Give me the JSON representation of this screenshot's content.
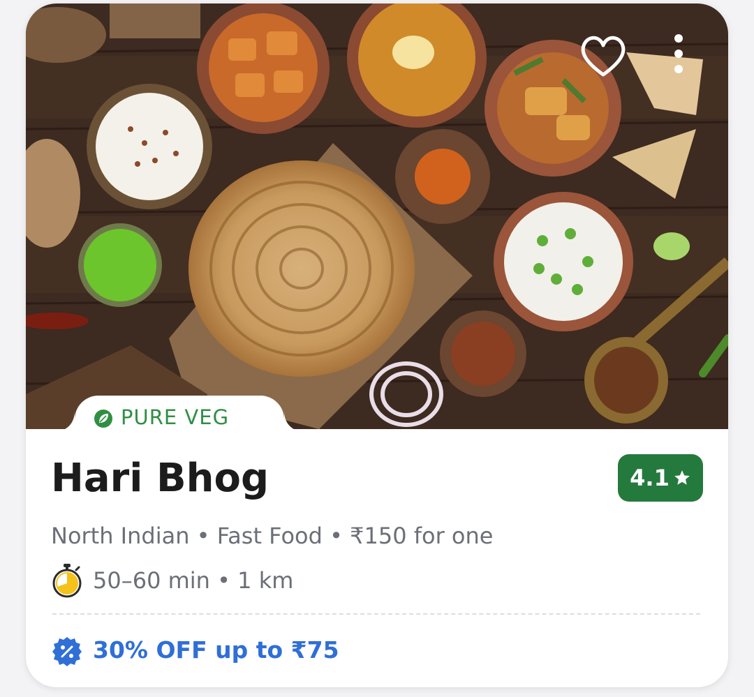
{
  "restaurant": {
    "tag": "PURE VEG",
    "name": "Hari Bhog",
    "rating": "4.1",
    "cuisines": "North Indian • Fast Food • ₹150 for one",
    "eta": "50–60 min • 1 km",
    "offer": "30% OFF up to ₹75"
  },
  "icons": {
    "favorite": "heart-outline-icon",
    "more": "vertical-ellipsis-icon",
    "veg": "leaf-icon",
    "rating": "star-icon",
    "eta": "stopwatch-icon",
    "offer": "discount-badge-icon"
  },
  "colors": {
    "rating_bg": "#247a3d",
    "veg_green": "#2f8f43",
    "offer_blue": "#2f6fd6",
    "timer_yellow": "#f4c21a"
  }
}
